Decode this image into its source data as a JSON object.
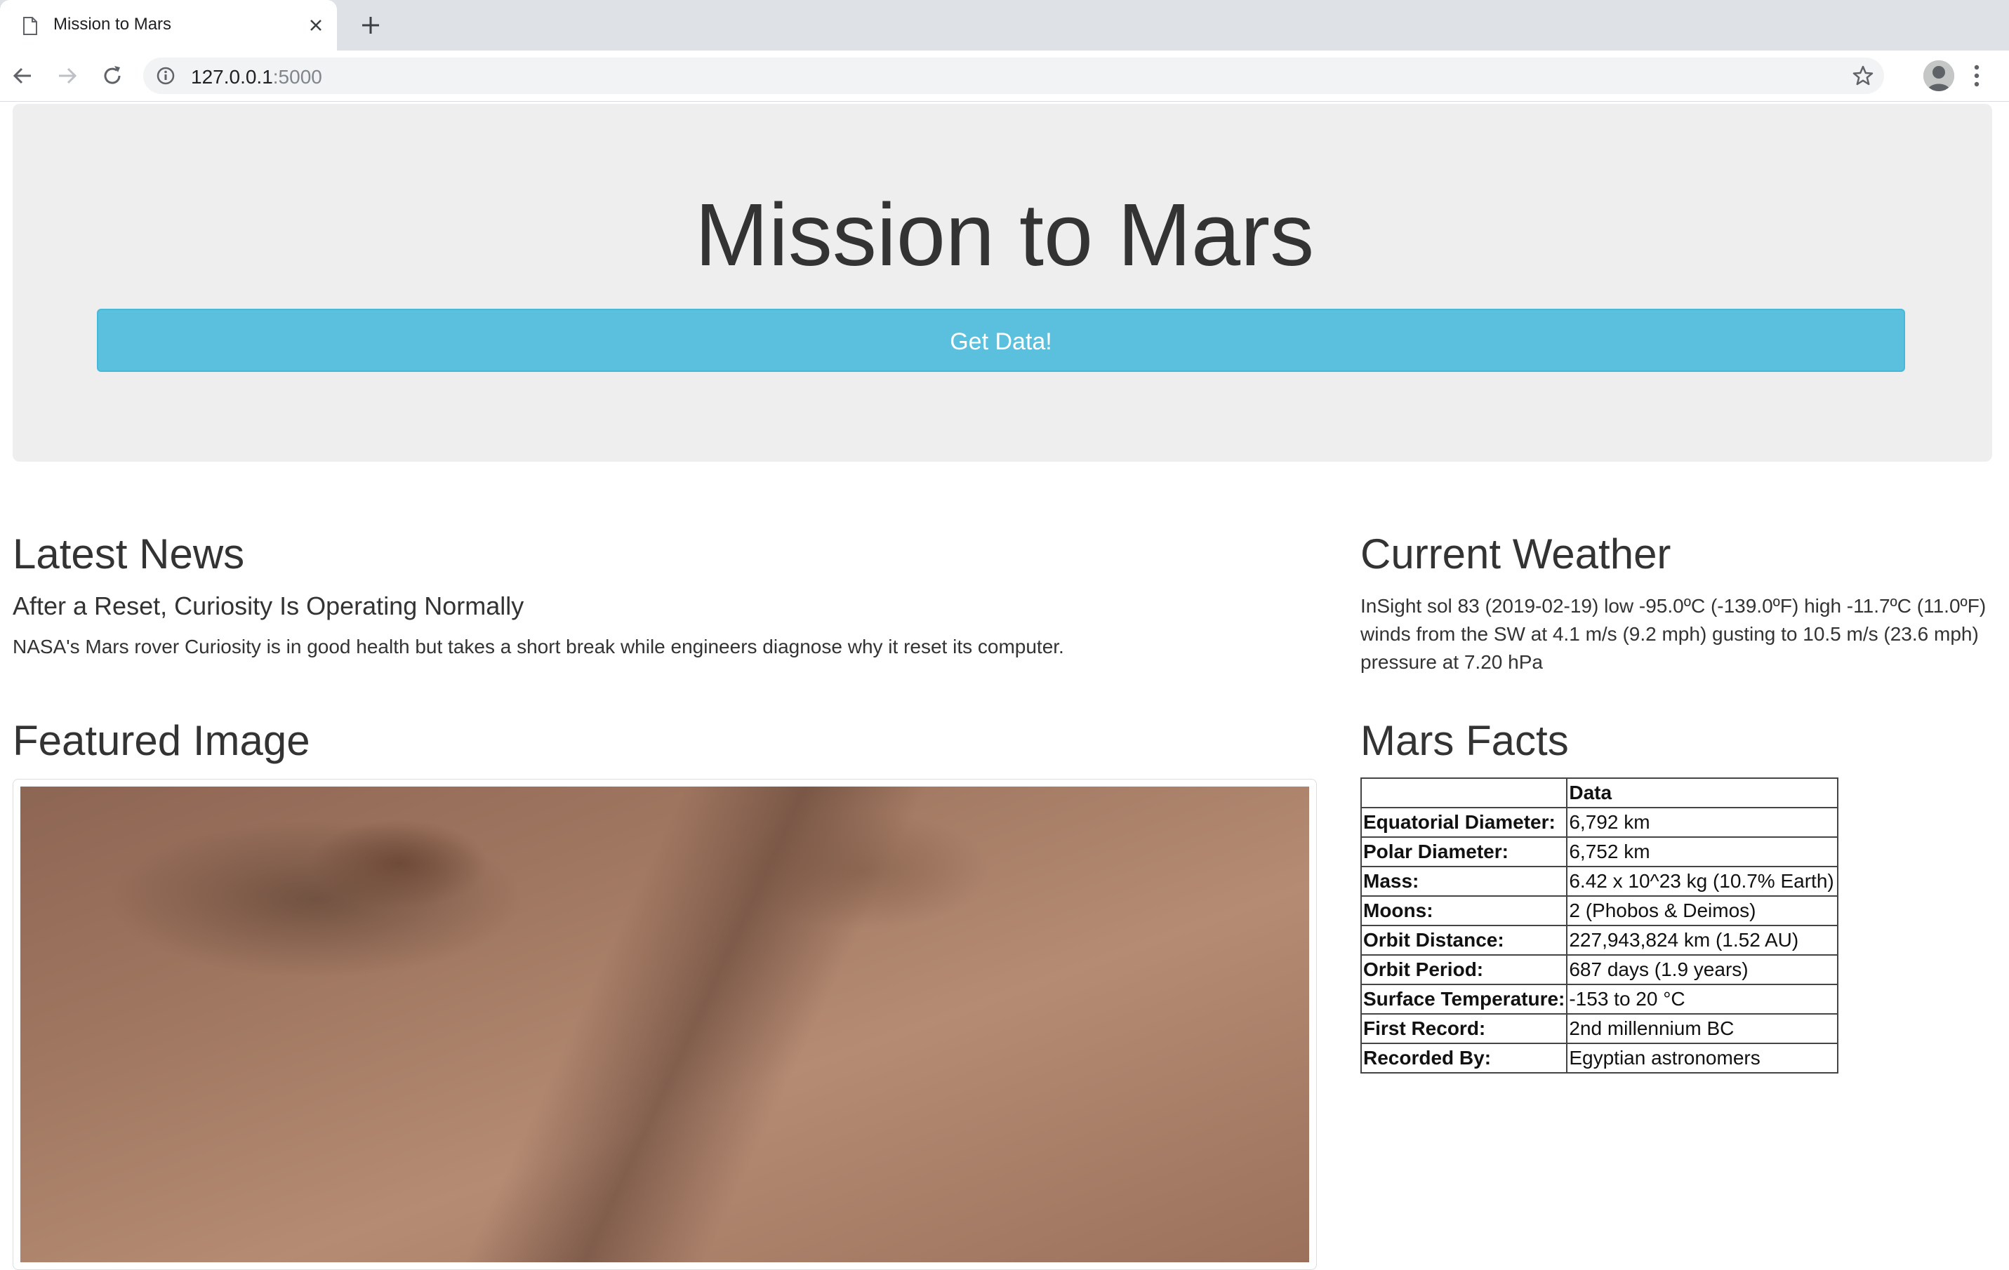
{
  "browser": {
    "tab_title": "Mission to Mars",
    "url_host": "127.0.0.1",
    "url_port": ":5000"
  },
  "header": {
    "title": "Mission to Mars",
    "button_label": "Get Data!"
  },
  "news": {
    "heading": "Latest News",
    "title": "After a Reset, Curiosity Is Operating Normally",
    "paragraph": "NASA's Mars rover Curiosity is in good health but takes a short break while engineers diagnose why it reset its computer."
  },
  "weather": {
    "heading": "Current Weather",
    "text": "InSight sol 83 (2019-02-19) low -95.0ºC (-139.0ºF) high -11.7ºC (11.0ºF) winds from the SW at 4.1 m/s (9.2 mph) gusting to 10.5 m/s (23.6 mph) pressure at 7.20 hPa"
  },
  "featured": {
    "heading": "Featured Image"
  },
  "facts": {
    "heading": "Mars Facts",
    "columns": [
      "",
      "Data"
    ],
    "rows": [
      {
        "label": "Equatorial Diameter:",
        "value": "6,792 km"
      },
      {
        "label": "Polar Diameter:",
        "value": "6,752 km"
      },
      {
        "label": "Mass:",
        "value": "6.42 x 10^23 kg (10.7% Earth)"
      },
      {
        "label": "Moons:",
        "value": "2 (Phobos & Deimos)"
      },
      {
        "label": "Orbit Distance:",
        "value": "227,943,824 km (1.52 AU)"
      },
      {
        "label": "Orbit Period:",
        "value": "687 days (1.9 years)"
      },
      {
        "label": "Surface Temperature:",
        "value": "-153 to 20 °C"
      },
      {
        "label": "First Record:",
        "value": "2nd millennium BC"
      },
      {
        "label": "Recorded By:",
        "value": "Egyptian astronomers"
      }
    ]
  },
  "icons": {
    "tab": "document-icon",
    "close": "close-icon",
    "new_tab": "plus-icon",
    "back": "arrow-left-icon",
    "forward": "arrow-right-icon",
    "reload": "reload-icon",
    "info": "info-icon",
    "bookmark": "star-icon",
    "menu": "kebab-menu-icon"
  },
  "colors": {
    "button": "#5bc0de",
    "jumbotron": "#eeeeee",
    "text": "#333333"
  }
}
